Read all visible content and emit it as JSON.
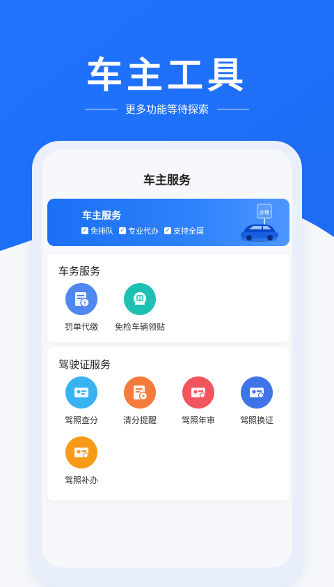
{
  "hero": {
    "title": "车主工具",
    "subtitle": "更多功能等待探索"
  },
  "screen": {
    "title": "车主服务"
  },
  "banner": {
    "title": "车主服务",
    "tags": [
      "免排队",
      "专业代办",
      "支持全国"
    ],
    "sign_text": "办理"
  },
  "sections": {
    "vehicle": {
      "title": "车务服务",
      "items": [
        {
          "label": "罚单代缴",
          "icon": "ticket-icon",
          "color": "#4f86f0"
        },
        {
          "label": "免检车辆领贴",
          "icon": "inspection-icon",
          "color": "#1fc0b4"
        }
      ]
    },
    "license": {
      "title": "驾驶证服务",
      "items": [
        {
          "label": "驾照查分",
          "icon": "license-icon",
          "color": "#38b3f1"
        },
        {
          "label": "清分提醒",
          "icon": "reminder-icon",
          "color": "#f57b3d"
        },
        {
          "label": "驾照年审",
          "icon": "license-icon",
          "color": "#f2555e"
        },
        {
          "label": "驾照换证",
          "icon": "license-icon",
          "color": "#3f73e8"
        },
        {
          "label": "驾照补办",
          "icon": "license-icon",
          "color": "#f69a18"
        }
      ]
    }
  },
  "colors": {
    "primary": "#1f72f6",
    "background": "#f5f7fb"
  }
}
